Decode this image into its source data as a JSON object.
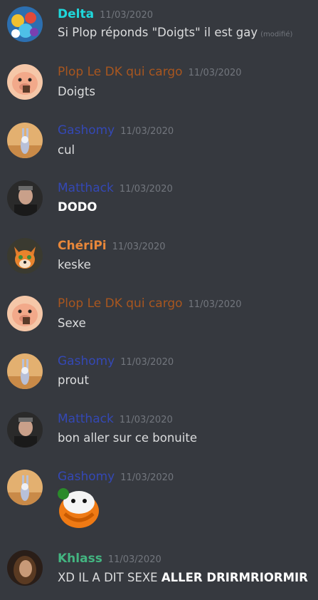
{
  "messages": [
    {
      "author": "Delta",
      "color": "#1fd8dc",
      "time": "11/03/2020",
      "text": "Si Plop réponds \"Doigts\" il est gay",
      "edited": "(modifié)",
      "avatar": "cartoon-group-avatar"
    },
    {
      "author": "Plop Le DK qui cargo",
      "color": "#a8561f",
      "time": "11/03/2020",
      "text": "Doigts",
      "avatar": "pig-avatar"
    },
    {
      "author": "Gashomy",
      "color": "#3448b5",
      "time": "11/03/2020",
      "text": "cul",
      "avatar": "rabbit-desert-avatar"
    },
    {
      "author": "Matthack",
      "color": "#3448b5",
      "time": "11/03/2020",
      "text": "DODO",
      "avatar": "man-portrait-avatar"
    },
    {
      "author": "ChériPi",
      "color": "#e8873a",
      "time": "11/03/2020",
      "text": "keske",
      "avatar": "fox-avatar"
    },
    {
      "author": "Plop Le DK qui cargo",
      "color": "#a8561f",
      "time": "11/03/2020",
      "text": "Sexe",
      "avatar": "pig-avatar"
    },
    {
      "author": "Gashomy",
      "color": "#3448b5",
      "time": "11/03/2020",
      "text": "prout",
      "avatar": "rabbit-desert-avatar"
    },
    {
      "author": "Matthack",
      "color": "#3448b5",
      "time": "11/03/2020",
      "text": "bon aller sur ce bonuite",
      "avatar": "man-portrait-avatar"
    },
    {
      "author": "Gashomy",
      "color": "#3448b5",
      "time": "11/03/2020",
      "image": "orange-clown-emoji",
      "avatar": "rabbit-desert-avatar"
    },
    {
      "author": "Khlass",
      "color": "#43b581",
      "time": "11/03/2020",
      "text": "XD IL A DIT SEXE ",
      "text_bold": "ALLER DRIRMRIORMIR",
      "avatar": "woman-portrait-avatar"
    }
  ]
}
